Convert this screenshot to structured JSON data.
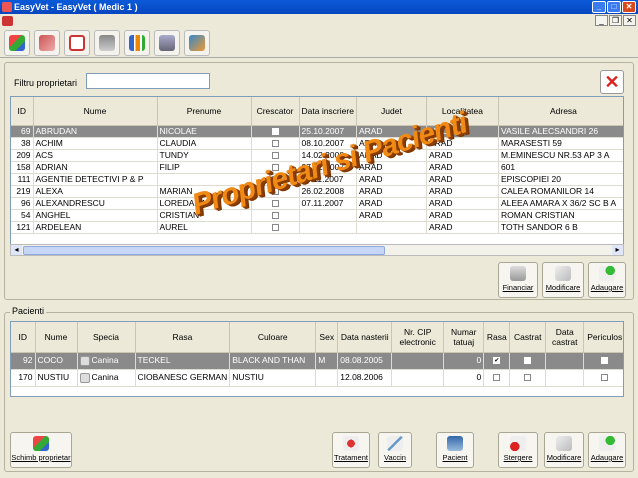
{
  "window": {
    "title": "EasyVet - EasyVet ( Medic 1 )"
  },
  "toolbar": {
    "icons": [
      "owners-icon",
      "patients-icon",
      "calendar-icon",
      "clinic-icon",
      "reports-icon",
      "cart-icon",
      "users-icon"
    ]
  },
  "owners": {
    "filter_label": "Filtru proprietari",
    "filter_value": "",
    "columns": [
      "ID",
      "Nume",
      "Prenume",
      "Crescator",
      "Data inscriere",
      "Judet",
      "Localitatea",
      "Adresa"
    ],
    "rows": [
      {
        "id": "69",
        "nume": "ABRUDAN",
        "prenume": "NICOLAE",
        "crescator": false,
        "data": "25.10.2007",
        "judet": "ARAD",
        "localitate": "LIPOVA",
        "adresa": "VASILE ALECSANDRI 26"
      },
      {
        "id": "38",
        "nume": "ACHIM",
        "prenume": "CLAUDIA",
        "crescator": false,
        "data": "08.10.2007",
        "judet": "ARAD",
        "localitate": "ARAD",
        "adresa": "MARASESTI 59"
      },
      {
        "id": "209",
        "nume": "ACS",
        "prenume": "TUNDY",
        "crescator": false,
        "data": "14.02.2008",
        "judet": "ARAD",
        "localitate": "ARAD",
        "adresa": "M.EMINESCU NR.53 AP 3 A"
      },
      {
        "id": "158",
        "nume": "ADRIAN",
        "prenume": "FILIP",
        "crescator": false,
        "data": "27.12.2007",
        "judet": "ARAD",
        "localitate": "ARAD",
        "adresa": "601"
      },
      {
        "id": "111",
        "nume": "AGENTIE DETECTIVI P & P",
        "prenume": "",
        "crescator": false,
        "data": "16.11.2007",
        "judet": "ARAD",
        "localitate": "ARAD",
        "adresa": "EPISCOPIEI 20"
      },
      {
        "id": "219",
        "nume": "ALEXA",
        "prenume": "MARIAN",
        "crescator": false,
        "data": "26.02.2008",
        "judet": "ARAD",
        "localitate": "ARAD",
        "adresa": "CALEA ROMANILOR 14"
      },
      {
        "id": "96",
        "nume": "ALEXANDRESCU",
        "prenume": "LOREDANA",
        "crescator": false,
        "data": "07.11.2007",
        "judet": "ARAD",
        "localitate": "ARAD",
        "adresa": "ALEEA AMARA X 36/2 SC B A"
      },
      {
        "id": "54",
        "nume": "ANGHEL",
        "prenume": "CRISTIAN",
        "crescator": false,
        "data": "",
        "judet": "ARAD",
        "localitate": "ARAD",
        "adresa": "ROMAN CRISTIAN"
      },
      {
        "id": "121",
        "nume": "ARDELEAN",
        "prenume": "AUREL",
        "crescator": false,
        "data": "",
        "judet": "",
        "localitate": "ARAD",
        "adresa": "TOTH SANDOR 6 B"
      }
    ],
    "buttons": {
      "financiar": "Financiar",
      "modificare": "Modificare",
      "adaugare": "Adaugare"
    }
  },
  "patients": {
    "section_label": "Pacienti",
    "columns": [
      "ID",
      "Nume",
      "Specia",
      "Rasa",
      "Culoare",
      "Sex",
      "Data nasterii",
      "Nr. CIP electronic",
      "Numar tatuaj",
      "Rasa",
      "Castrat",
      "Data castrat",
      "Periculos"
    ],
    "rows": [
      {
        "id": "92",
        "nume": "COCO",
        "specia": "Canina",
        "rasa": "TECKEL",
        "culoare": "BLACK AND THAN",
        "sex": "M",
        "data": "08.08.2005",
        "cip": "",
        "tatuaj": "0",
        "rasa_flag": true,
        "castrat": false,
        "data_castrat": "",
        "periculos": false
      },
      {
        "id": "170",
        "nume": "NUSTIU",
        "specia": "Canina",
        "rasa": "CIOBANESC GERMAN",
        "culoare": "NUSTIU",
        "sex": "",
        "data": "12.08.2006",
        "cip": "",
        "tatuaj": "0",
        "rasa_flag": false,
        "castrat": false,
        "data_castrat": "",
        "periculos": false
      }
    ],
    "buttons": {
      "schimb": "Schimb proprietar",
      "tratament": "Tratament",
      "vaccin": "Vaccin",
      "pacient": "Pacient",
      "stergere": "Stergere",
      "modificare": "Modificare",
      "adaugare": "Adaugare"
    }
  },
  "overlay_text": "Proprietari si Pacienti",
  "colors": {
    "title_bar": "#0a5bd8",
    "selected_row": "#8a8a8a",
    "watermark": "#f08a15"
  }
}
